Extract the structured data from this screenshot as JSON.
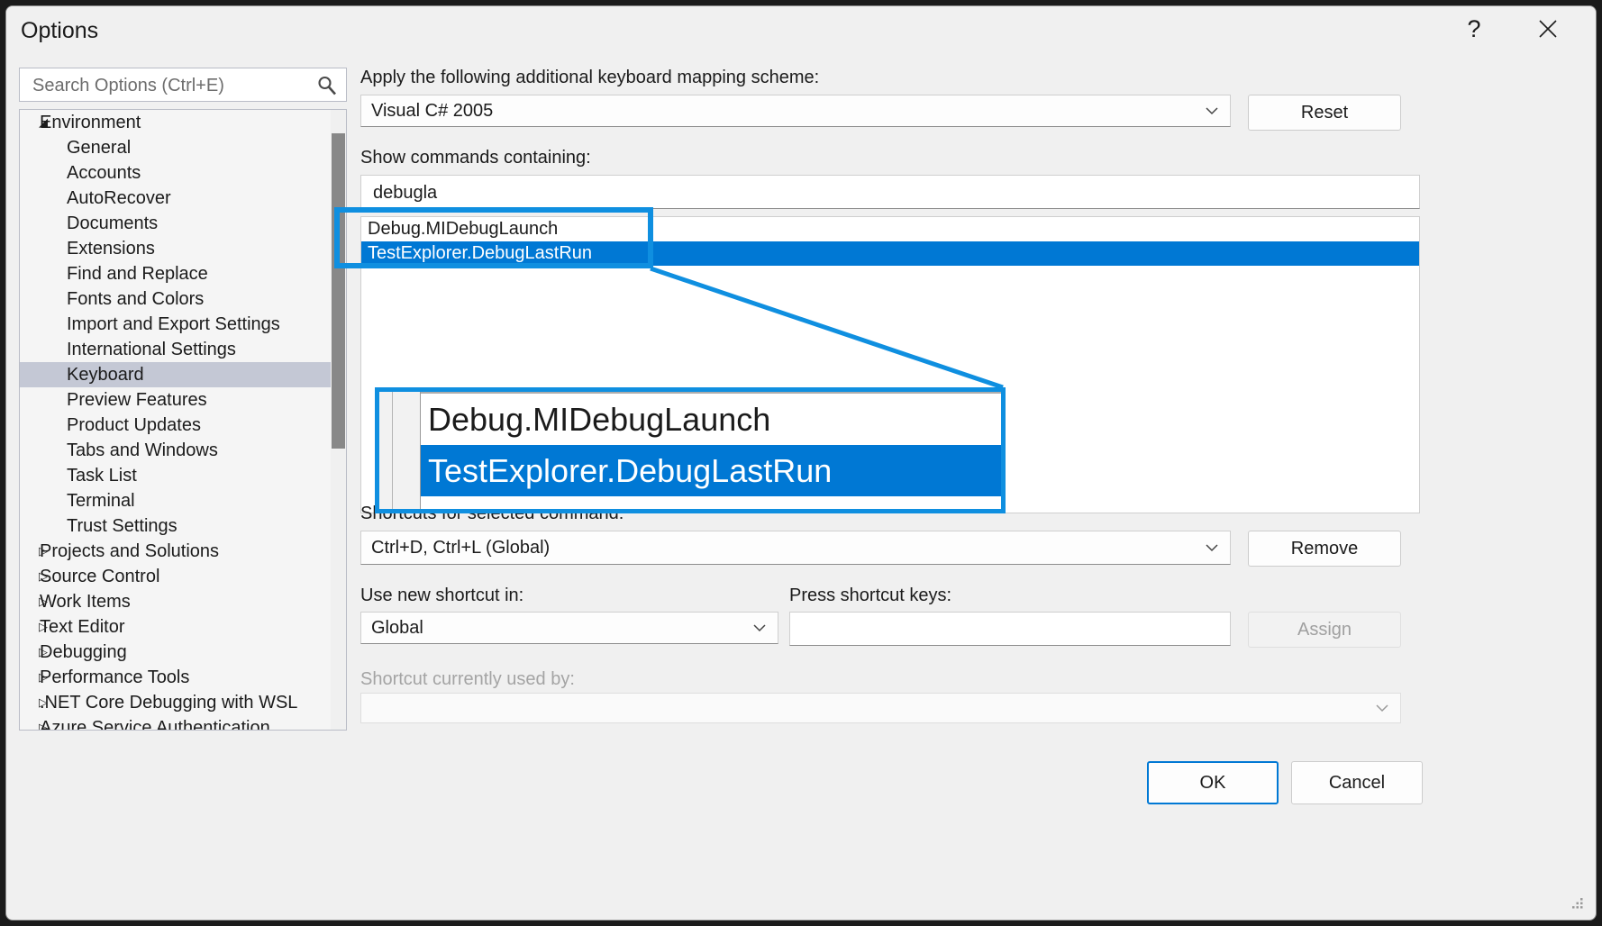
{
  "window": {
    "title": "Options",
    "help_icon": "question-mark-icon",
    "close_icon": "close-icon"
  },
  "search": {
    "placeholder": "Search Options (Ctrl+E)",
    "value": "",
    "icon": "search-icon"
  },
  "sidebar": {
    "items": [
      {
        "label": "Environment",
        "level": 0,
        "expander": "expanded",
        "selected": false
      },
      {
        "label": "General",
        "level": 1,
        "expander": "none",
        "selected": false
      },
      {
        "label": "Accounts",
        "level": 1,
        "expander": "none",
        "selected": false
      },
      {
        "label": "AutoRecover",
        "level": 1,
        "expander": "none",
        "selected": false
      },
      {
        "label": "Documents",
        "level": 1,
        "expander": "none",
        "selected": false
      },
      {
        "label": "Extensions",
        "level": 1,
        "expander": "none",
        "selected": false
      },
      {
        "label": "Find and Replace",
        "level": 1,
        "expander": "none",
        "selected": false
      },
      {
        "label": "Fonts and Colors",
        "level": 1,
        "expander": "none",
        "selected": false
      },
      {
        "label": "Import and Export Settings",
        "level": 1,
        "expander": "none",
        "selected": false
      },
      {
        "label": "International Settings",
        "level": 1,
        "expander": "none",
        "selected": false
      },
      {
        "label": "Keyboard",
        "level": 1,
        "expander": "none",
        "selected": true
      },
      {
        "label": "Preview Features",
        "level": 1,
        "expander": "none",
        "selected": false
      },
      {
        "label": "Product Updates",
        "level": 1,
        "expander": "none",
        "selected": false
      },
      {
        "label": "Tabs and Windows",
        "level": 1,
        "expander": "none",
        "selected": false
      },
      {
        "label": "Task List",
        "level": 1,
        "expander": "none",
        "selected": false
      },
      {
        "label": "Terminal",
        "level": 1,
        "expander": "none",
        "selected": false
      },
      {
        "label": "Trust Settings",
        "level": 1,
        "expander": "none",
        "selected": false
      },
      {
        "label": "Projects and Solutions",
        "level": 0,
        "expander": "collapsed",
        "selected": false
      },
      {
        "label": "Source Control",
        "level": 0,
        "expander": "collapsed",
        "selected": false
      },
      {
        "label": "Work Items",
        "level": 0,
        "expander": "collapsed",
        "selected": false
      },
      {
        "label": "Text Editor",
        "level": 0,
        "expander": "collapsed",
        "selected": false
      },
      {
        "label": "Debugging",
        "level": 0,
        "expander": "collapsed",
        "selected": false
      },
      {
        "label": "Performance Tools",
        "level": 0,
        "expander": "collapsed",
        "selected": false
      },
      {
        "label": ".NET Core Debugging with WSL",
        "level": 0,
        "expander": "collapsed",
        "selected": false
      },
      {
        "label": "Azure Service Authentication",
        "level": 0,
        "expander": "collapsed",
        "selected": false
      }
    ]
  },
  "main": {
    "scheme_label": "Apply the following additional keyboard mapping scheme:",
    "scheme_value": "Visual C# 2005",
    "reset_button": "Reset",
    "filter_label": "Show commands containing:",
    "filter_value": "debugla",
    "commands": [
      {
        "label": "Debug.MIDebugLaunch",
        "selected": false
      },
      {
        "label": "TestExplorer.DebugLastRun",
        "selected": true
      }
    ],
    "shortcuts_label": "Shortcuts for selected command:",
    "shortcuts_value": "Ctrl+D, Ctrl+L (Global)",
    "remove_button": "Remove",
    "use_shortcut_label": "Use new shortcut in:",
    "use_shortcut_value": "Global",
    "press_keys_label": "Press shortcut keys:",
    "press_keys_value": "",
    "assign_button": "Assign",
    "used_by_label": "Shortcut currently used by:",
    "used_by_value": ""
  },
  "callout": {
    "rows": [
      {
        "label": "Debug.MIDebugLaunch",
        "selected": false
      },
      {
        "label": "TestExplorer.DebugLastRun",
        "selected": true
      }
    ],
    "highlight_color": "#0f8fe0",
    "selection_color": "#0078d4"
  },
  "footer": {
    "ok_button": "OK",
    "cancel_button": "Cancel"
  }
}
